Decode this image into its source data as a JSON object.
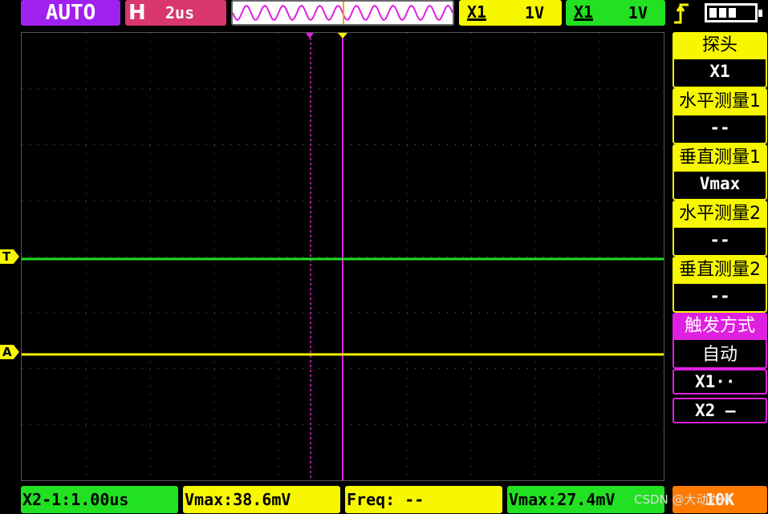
{
  "top_bar": {
    "mode": "AUTO",
    "timebase_label": "H",
    "timebase_value": "2us",
    "ch1": {
      "coupling": "X1",
      "volts": "1V",
      "color": "#f7f700"
    },
    "ch2": {
      "coupling": "X1",
      "volts": "1V",
      "color": "#22e022"
    }
  },
  "menu": {
    "items": [
      {
        "label": "探头",
        "value": "X1"
      },
      {
        "label": "水平测量1",
        "value": "--"
      },
      {
        "label": "垂直测量1",
        "value": "Vmax"
      },
      {
        "label": "水平测量2",
        "value": "--"
      },
      {
        "label": "垂直测量2",
        "value": "--"
      },
      {
        "label": "触发方式",
        "value": "自动"
      }
    ],
    "cursor_x1": "X1··",
    "cursor_x2": "X2 —"
  },
  "markers": {
    "trigger": "T",
    "channel": "A"
  },
  "bottom_bar": {
    "delta": "X2-1:1.00us",
    "ch1_vmax": "Vmax:38.6mV",
    "freq": "Freq: --",
    "ch2_vmax": "Vmax:27.4mV",
    "right": "10K"
  },
  "watermark": "CSDN @大动力M"
}
